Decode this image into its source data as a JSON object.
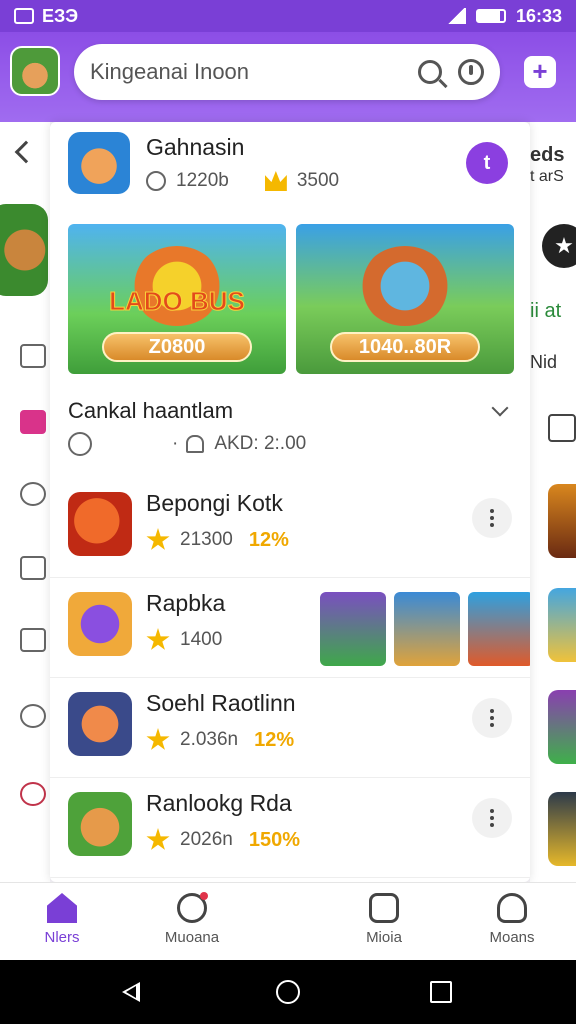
{
  "status_bar": {
    "left_text": "ЕЗЭ",
    "time": "16:33"
  },
  "header": {
    "search_text": "Kingeanai Inoon",
    "add_label": "+"
  },
  "right_peek": {
    "top_text": "eds",
    "top_sub": "t arS",
    "mid_text": "ii at",
    "nid_text": "Nid"
  },
  "app": {
    "title": "Gahnasin",
    "downloads": "1220b",
    "crowns": "3500",
    "profile_letter": "t"
  },
  "banners": [
    {
      "logo": "LADO BUS",
      "pill": "Z0800"
    },
    {
      "logo": "",
      "pill": "1040..80R"
    }
  ],
  "section": {
    "title": "Cankal haantlam",
    "meta": "AKD: 2:.00"
  },
  "items": [
    {
      "name": "Bepongi Kotk",
      "rating": "21300",
      "pct": "12%",
      "icon_color": "#d9451e"
    },
    {
      "name": "Rapbka",
      "rating": "1400",
      "pct": "",
      "icon_color": "#8a3fd6"
    },
    {
      "name": "Soehl Raotlinn",
      "rating": "2.036n",
      "pct": "12%",
      "icon_color": "#e07a35"
    },
    {
      "name": "Ranlookg Rda",
      "rating": "2026n",
      "pct": "150%",
      "icon_color": "#4ea23a"
    }
  ],
  "bottom_nav": [
    {
      "label": "Nlers",
      "icon": "home-icon"
    },
    {
      "label": "Muoana",
      "icon": "compass-icon"
    },
    {
      "label": "Mioia",
      "icon": "media-icon"
    },
    {
      "label": "Moans",
      "icon": "user-icon"
    }
  ],
  "colors": {
    "accent": "#7a3fd6",
    "star": "#f5b800"
  }
}
